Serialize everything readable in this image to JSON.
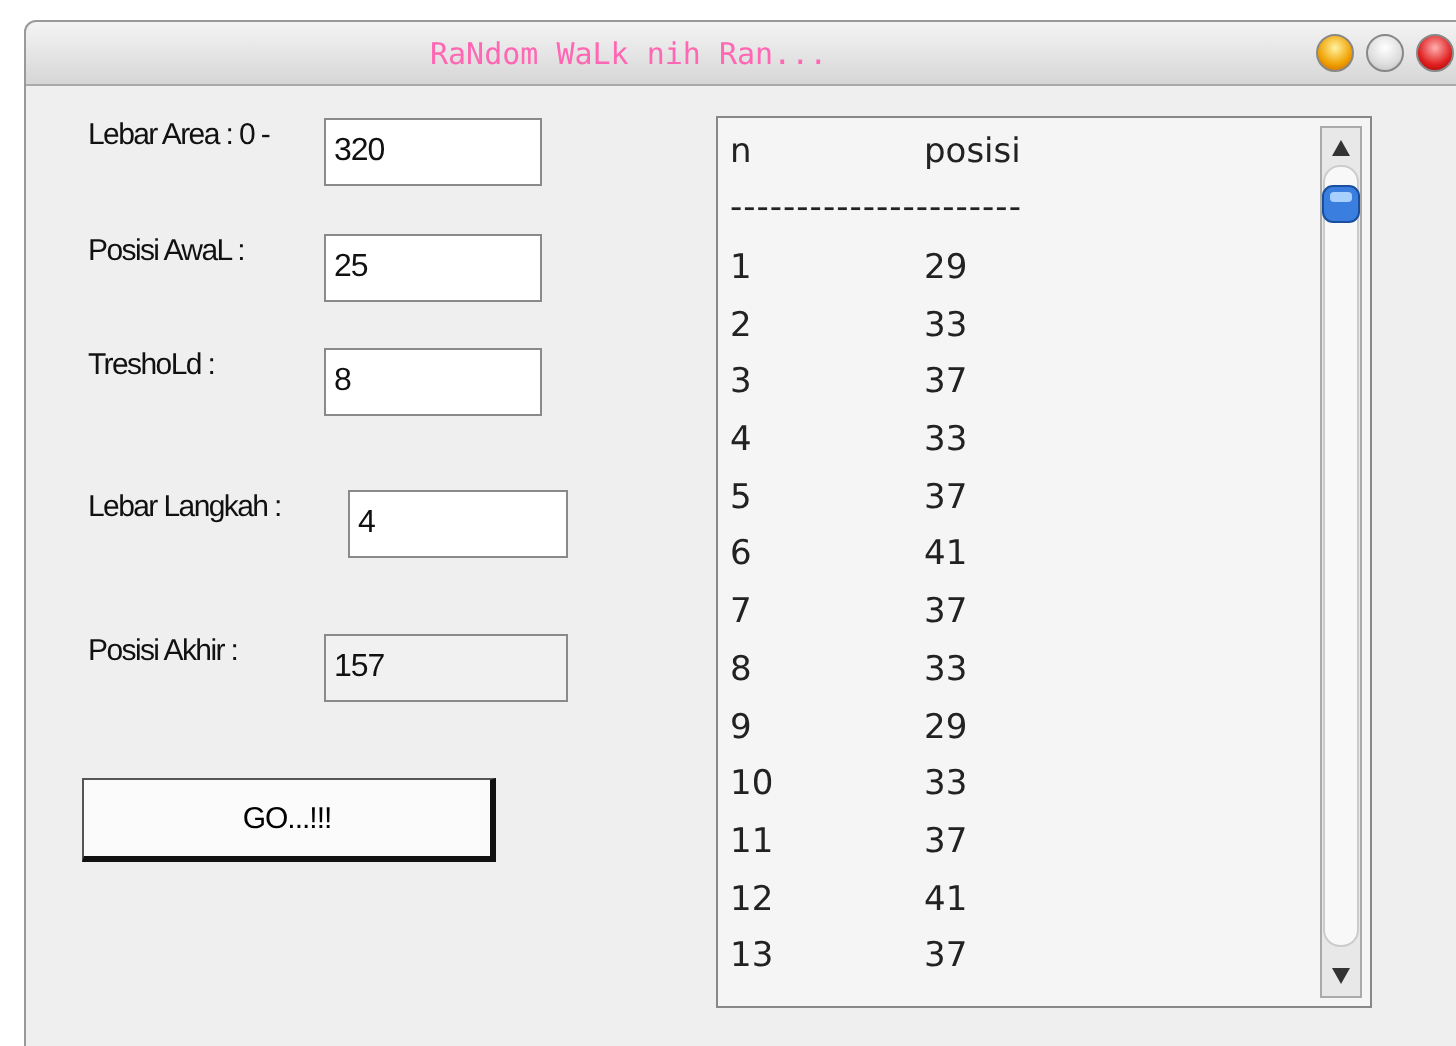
{
  "window": {
    "title": "RaNdom WaLk nih Ran..."
  },
  "fields": [
    {
      "label": "Lebar Area : 0 -",
      "value": "320",
      "disabled": false
    },
    {
      "label": "Posisi AwaL :",
      "value": "25",
      "disabled": false
    },
    {
      "label": "TreshoLd :",
      "value": "8",
      "disabled": false
    },
    {
      "label": "Lebar Langkah :",
      "value": "4",
      "disabled": false
    },
    {
      "label": "Posisi Akhir :",
      "value": "157",
      "disabled": true
    }
  ],
  "go_button": "GO...!!!",
  "output_list": {
    "header": [
      "n",
      "posisi"
    ],
    "separator": "----------------------",
    "rows": [
      {
        "n": "1",
        "posisi": "29"
      },
      {
        "n": "2",
        "posisi": "33"
      },
      {
        "n": "3",
        "posisi": "37"
      },
      {
        "n": "4",
        "posisi": "33"
      },
      {
        "n": "5",
        "posisi": "37"
      },
      {
        "n": "6",
        "posisi": "41"
      },
      {
        "n": "7",
        "posisi": "37"
      },
      {
        "n": "8",
        "posisi": "33"
      },
      {
        "n": "9",
        "posisi": "29"
      },
      {
        "n": "10",
        "posisi": "33"
      },
      {
        "n": "11",
        "posisi": "37"
      },
      {
        "n": "12",
        "posisi": "41"
      },
      {
        "n": "13",
        "posisi": "37"
      }
    ]
  }
}
